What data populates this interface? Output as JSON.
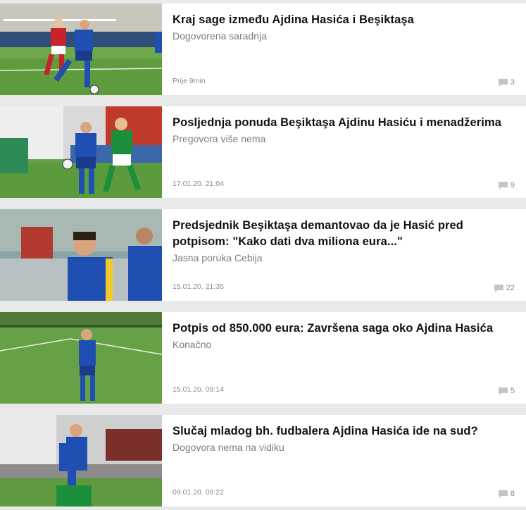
{
  "articles": [
    {
      "title": "Kraj sage između Ajdina Hasića i Beşiktaşa",
      "subtitle": "Dogovorena saradnja",
      "date": "Prije 9min",
      "comments": "3"
    },
    {
      "title": "Posljednja ponuda Beşiktaşa Ajdinu Hasiću i menadžerima",
      "subtitle": "Pregovora više nema",
      "date": "17.01.20. 21:04",
      "comments": "9"
    },
    {
      "title": "Predsjednik Beşiktaşa demantovao da je Hasić pred potpisom: \"Kako dati dva miliona eura...\"",
      "subtitle": "Jasna poruka Cebija",
      "date": "15.01.20. 21:35",
      "comments": "22"
    },
    {
      "title": "Potpis od 850.000 eura: Završena saga oko Ajdina Hasića",
      "subtitle": "Konačno",
      "date": "15.01.20. 09:14",
      "comments": "5"
    },
    {
      "title": "Slučaj mladog bh. fudbalera Ajdina Hasića ide na sud?",
      "subtitle": "Dogovora nema na vidiku",
      "date": "09.01.20. 09:22",
      "comments": "8"
    }
  ]
}
